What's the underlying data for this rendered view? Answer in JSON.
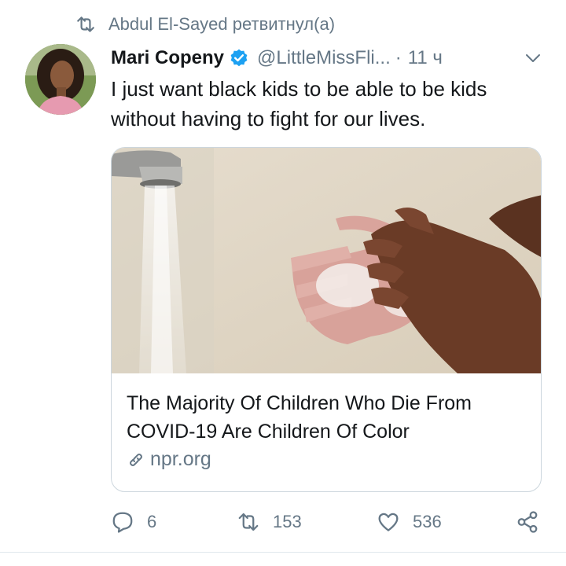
{
  "retweet_context": {
    "icon": "retweet-icon",
    "text": "Abdul El-Sayed ретвитнул(а)"
  },
  "author": {
    "name": "Mari Copeny",
    "verified": true,
    "handle": "@LittleMissFli...",
    "separator": "·",
    "time": "11 ч"
  },
  "tweet": {
    "text": "I just want black kids to be able to be kids without having to fight for our lives."
  },
  "link_card": {
    "image_subject": "child washing soapy hands under running faucet",
    "title": "The Majority Of Children Who Die From COVID-19 Are Children Of Color",
    "domain": "npr.org"
  },
  "actions": {
    "reply_count": "6",
    "retweet_count": "153",
    "like_count": "536"
  },
  "colors": {
    "secondary_text": "#657786",
    "primary_text": "#14171a",
    "verified_blue": "#1da1f2",
    "border": "#ccd6dd"
  }
}
